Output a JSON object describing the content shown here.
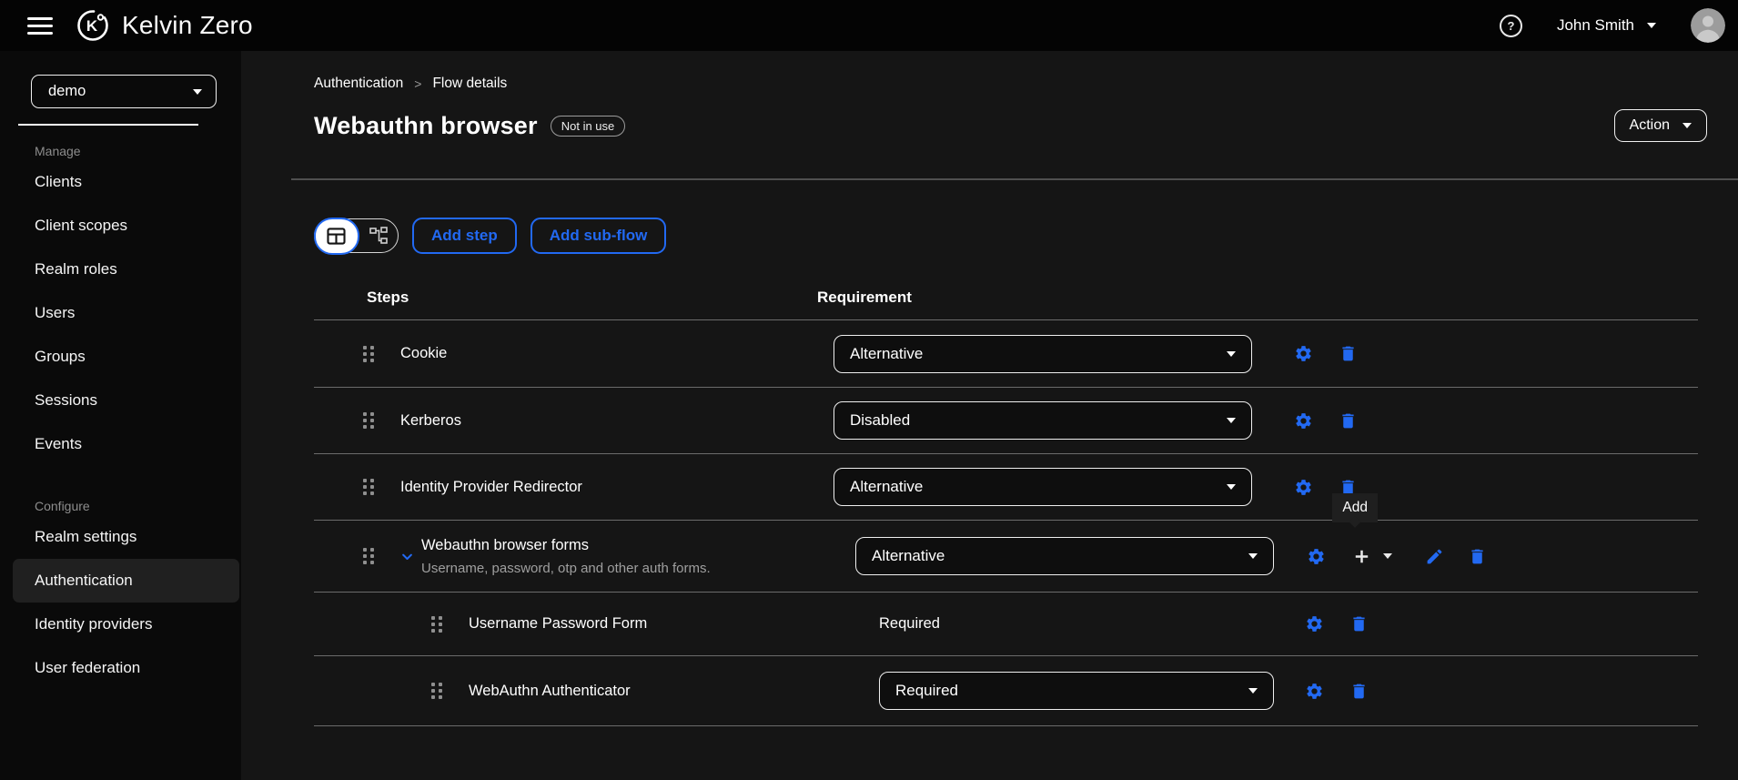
{
  "topbar": {
    "brand": "Kelvin Zero",
    "logo_letter": "K",
    "user_name": "John Smith"
  },
  "icons": {
    "help_glyph": "?"
  },
  "sidebar": {
    "realm": "demo",
    "manage_label": "Manage",
    "manage_items": [
      "Clients",
      "Client scopes",
      "Realm roles",
      "Users",
      "Groups",
      "Sessions",
      "Events"
    ],
    "configure_label": "Configure",
    "configure_items": [
      "Realm settings",
      "Authentication",
      "Identity providers",
      "User federation"
    ],
    "active_item": "Authentication"
  },
  "breadcrumb": {
    "parent": "Authentication",
    "separator": ">",
    "current": "Flow details"
  },
  "page": {
    "title": "Webauthn browser",
    "badge": "Not in use",
    "action": "Action"
  },
  "toolbar": {
    "add_step": "Add step",
    "add_subflow": "Add sub-flow"
  },
  "table": {
    "col_steps": "Steps",
    "col_requirement": "Requirement",
    "rows": [
      {
        "name": "Cookie",
        "requirement": "Alternative"
      },
      {
        "name": "Kerberos",
        "requirement": "Disabled"
      },
      {
        "name": "Identity Provider Redirector",
        "requirement": "Alternative"
      },
      {
        "name": "Webauthn browser forms",
        "description": "Username, password, otp and other auth forms.",
        "requirement": "Alternative",
        "expanded": true
      },
      {
        "name": "Username Password Form",
        "requirement": "Required"
      },
      {
        "name": "WebAuthn Authenticator",
        "requirement": "Required"
      }
    ]
  },
  "tooltip": {
    "label": "Add"
  },
  "colors": {
    "accent": "#2269f2",
    "background": "#151515",
    "sidebar": "#0a0a0a",
    "topbar": "#040404"
  }
}
